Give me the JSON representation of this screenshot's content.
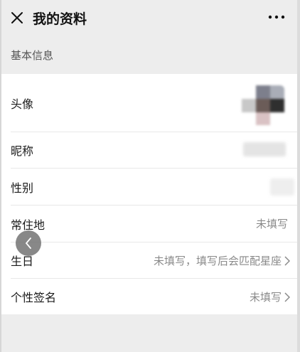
{
  "header": {
    "title": "我的资料",
    "close_icon": "close-icon",
    "more_icon": "more-horizontal-icon"
  },
  "section": {
    "label": "基本信息"
  },
  "rows": [
    {
      "label": "头像"
    },
    {
      "label": "昵称"
    },
    {
      "label": "性别"
    },
    {
      "label": "常住地",
      "value": "未填写"
    },
    {
      "label": "生日",
      "value": "未填写，填写后会匹配星座"
    },
    {
      "label": "个性签名",
      "value": "未填写"
    }
  ],
  "floating": {
    "back_icon": "chevron-left-icon"
  },
  "colors": {
    "background": "#ededed",
    "card": "#ffffff",
    "secondary_text": "#8a8a8a"
  }
}
